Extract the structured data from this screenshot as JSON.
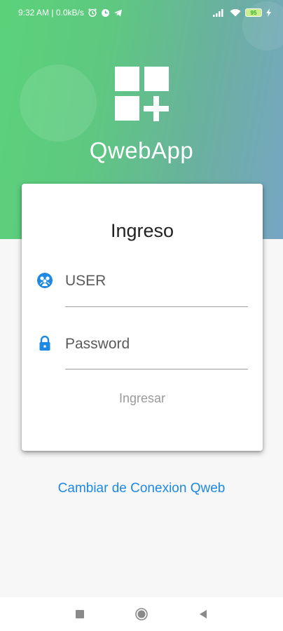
{
  "status_bar": {
    "time_data": "9:32 AM | 0.0kB/s",
    "battery": "95",
    "icons": [
      "alarm-icon",
      "sync-icon",
      "telegram-icon",
      "signal-icon",
      "wifi-icon",
      "battery-icon",
      "charging-icon"
    ]
  },
  "header": {
    "app_name": "QwebApp",
    "logo_icon": "apps-add-icon",
    "gradient_colors": [
      "#5bd27a",
      "#77a6c4"
    ]
  },
  "login": {
    "title": "Ingreso",
    "user_placeholder": "USER",
    "user_value": "",
    "password_placeholder": "Password",
    "password_value": "",
    "submit_label": "Ingresar",
    "user_icon": "user-group-icon",
    "password_icon": "lock-icon"
  },
  "footer": {
    "switch_connection_label": "Cambiar de Conexion Qweb",
    "link_color": "#1e88e5"
  },
  "nav": {
    "icons": [
      "recent-apps-icon",
      "home-icon",
      "back-icon"
    ]
  }
}
